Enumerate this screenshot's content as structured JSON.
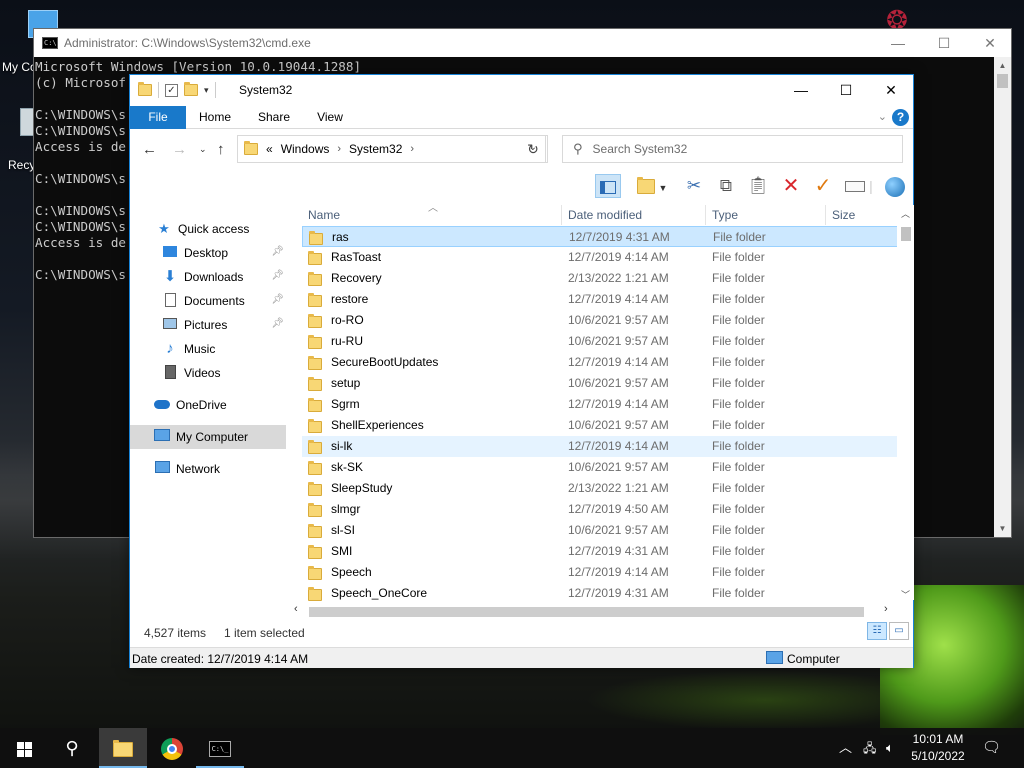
{
  "desktop": {
    "icon1_label": "My Co",
    "icon2_label": "Recy"
  },
  "cmd": {
    "title": "Administrator: C:\\Windows\\System32\\cmd.exe",
    "lines": [
      "Microsoft Windows [Version 10.0.19044.1288]",
      "(c) Microsof",
      "",
      "C:\\WINDOWS\\s",
      "C:\\WINDOWS\\s",
      "Access is de",
      "",
      "C:\\WINDOWS\\s",
      "",
      "C:\\WINDOWS\\s",
      "C:\\WINDOWS\\s",
      "Access is de",
      "",
      "C:\\WINDOWS\\s"
    ]
  },
  "explorer": {
    "title": "System32",
    "tabs": {
      "file": "File",
      "home": "Home",
      "share": "Share",
      "view": "View"
    },
    "help": "?",
    "address": {
      "prefix": "«",
      "crumbs": [
        "Windows",
        "System32"
      ]
    },
    "search": {
      "placeholder": "Search System32"
    },
    "nav": {
      "quick_access": "Quick access",
      "desktop": "Desktop",
      "downloads": "Downloads",
      "documents": "Documents",
      "pictures": "Pictures",
      "music": "Music",
      "videos": "Videos",
      "onedrive": "OneDrive",
      "my_computer": "My Computer",
      "network": "Network"
    },
    "columns": {
      "name": "Name",
      "date": "Date modified",
      "type": "Type",
      "size": "Size"
    },
    "rows": [
      {
        "name": "ras",
        "date": "12/7/2019 4:31 AM",
        "type": "File folder"
      },
      {
        "name": "RasToast",
        "date": "12/7/2019 4:14 AM",
        "type": "File folder"
      },
      {
        "name": "Recovery",
        "date": "2/13/2022 1:21 AM",
        "type": "File folder"
      },
      {
        "name": "restore",
        "date": "12/7/2019 4:14 AM",
        "type": "File folder"
      },
      {
        "name": "ro-RO",
        "date": "10/6/2021 9:57 AM",
        "type": "File folder"
      },
      {
        "name": "ru-RU",
        "date": "10/6/2021 9:57 AM",
        "type": "File folder"
      },
      {
        "name": "SecureBootUpdates",
        "date": "12/7/2019 4:14 AM",
        "type": "File folder"
      },
      {
        "name": "setup",
        "date": "10/6/2021 9:57 AM",
        "type": "File folder"
      },
      {
        "name": "Sgrm",
        "date": "12/7/2019 4:14 AM",
        "type": "File folder"
      },
      {
        "name": "ShellExperiences",
        "date": "10/6/2021 9:57 AM",
        "type": "File folder"
      },
      {
        "name": "si-lk",
        "date": "12/7/2019 4:14 AM",
        "type": "File folder"
      },
      {
        "name": "sk-SK",
        "date": "10/6/2021 9:57 AM",
        "type": "File folder"
      },
      {
        "name": "SleepStudy",
        "date": "2/13/2022 1:21 AM",
        "type": "File folder"
      },
      {
        "name": "slmgr",
        "date": "12/7/2019 4:50 AM",
        "type": "File folder"
      },
      {
        "name": "sl-SI",
        "date": "10/6/2021 9:57 AM",
        "type": "File folder"
      },
      {
        "name": "SMI",
        "date": "12/7/2019 4:31 AM",
        "type": "File folder"
      },
      {
        "name": "Speech",
        "date": "12/7/2019 4:14 AM",
        "type": "File folder"
      },
      {
        "name": "Speech_OneCore",
        "date": "12/7/2019 4:31 AM",
        "type": "File folder"
      }
    ],
    "status": {
      "items": "4,527 items",
      "selected": "1 item selected"
    },
    "details_bar": {
      "date_created": "Date created: 12/7/2019 4:14 AM",
      "location": "Computer"
    }
  },
  "taskbar": {
    "time": "10:01 AM",
    "date": "5/10/2022"
  }
}
